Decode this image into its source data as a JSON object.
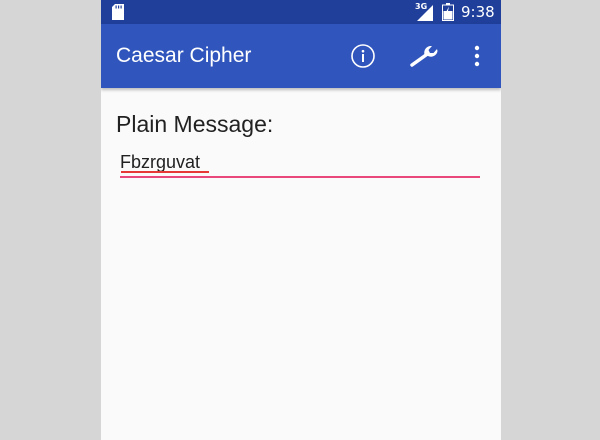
{
  "status_bar": {
    "network_label": "3G",
    "time": "9:38",
    "sd_card_icon": "sd-card-icon",
    "signal_icon": "signal-icon",
    "battery_icon": "battery-icon"
  },
  "app_bar": {
    "title": "Caesar Cipher",
    "actions": [
      {
        "name": "info",
        "icon": "info-icon"
      },
      {
        "name": "settings",
        "icon": "wrench-icon"
      },
      {
        "name": "overflow",
        "icon": "more-vert-icon"
      }
    ]
  },
  "form": {
    "plain_label": "Plain Message:",
    "plain_value": "Fbzrguvat",
    "plain_placeholder": ""
  },
  "colors": {
    "status_bar": "#1f3f9a",
    "app_bar": "#3056bd",
    "accent": "#e8497a",
    "background": "#fafafa",
    "outer": "#d6d6d6"
  }
}
